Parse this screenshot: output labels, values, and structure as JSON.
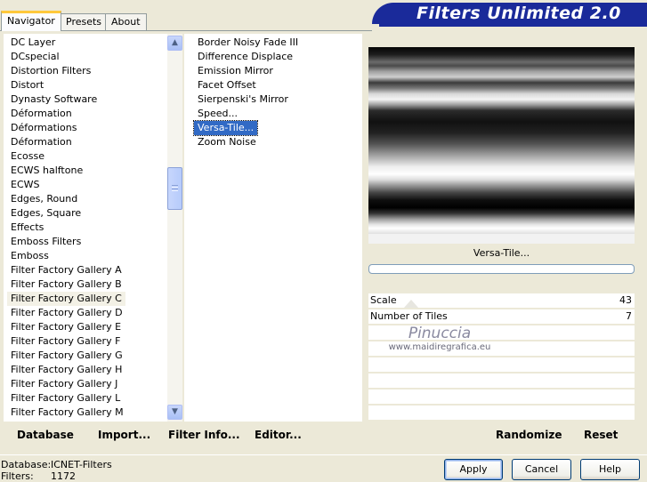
{
  "tabs": [
    {
      "label": "Navigator",
      "active": true
    },
    {
      "label": "Presets",
      "active": false
    },
    {
      "label": "About",
      "active": false
    }
  ],
  "app_title": "Filters Unlimited 2.0",
  "categories": [
    "DC Layer",
    "DCspecial",
    "Distortion Filters",
    "Distort",
    "Dynasty Software",
    "Déformation",
    "Déformations",
    "Déformation",
    "Ecosse",
    "ECWS halftone",
    "ECWS",
    "Edges, Round",
    "Edges, Square",
    "Effects",
    "Emboss Filters",
    "Emboss",
    "Filter Factory Gallery A",
    "Filter Factory Gallery B",
    "Filter Factory Gallery C",
    "Filter Factory Gallery D",
    "Filter Factory Gallery E",
    "Filter Factory Gallery F",
    "Filter Factory Gallery G",
    "Filter Factory Gallery H",
    "Filter Factory Gallery J",
    "Filter Factory Gallery L",
    "Filter Factory Gallery M"
  ],
  "selected_category": "Filter Factory Gallery C",
  "filters": [
    "Border Noisy Fade III",
    "Difference Displace",
    "Emission Mirror",
    "Facet Offset",
    "Sierpenski's Mirror",
    "Speed...",
    "Versa-Tile...",
    "Zoom Noise"
  ],
  "selected_filter": "Versa-Tile...",
  "preview": {
    "filter_name": "Versa-Tile..."
  },
  "parameters": [
    {
      "label": "Scale",
      "value": "43"
    },
    {
      "label": "Number of Tiles",
      "value": "7"
    }
  ],
  "watermark": {
    "line1": "Pinuccia",
    "line2": "www.maidiregrafica.eu"
  },
  "links": {
    "database": "Database",
    "import": "Import...",
    "filter_info": "Filter Info...",
    "editor": "Editor...",
    "randomize": "Randomize",
    "reset": "Reset"
  },
  "status": {
    "database_label": "Database:",
    "database_value": "ICNET-Filters",
    "filters_label": "Filters:",
    "filters_value": "1172"
  },
  "buttons": {
    "apply": "Apply",
    "cancel": "Cancel",
    "help": "Help"
  },
  "icons": {
    "scroll_up": "chevron-up-icon",
    "scroll_down": "chevron-down-icon"
  },
  "colors": {
    "banner": "#1a2a9a",
    "selection": "#316ac5",
    "tab_highlight": "#ffc83c"
  }
}
